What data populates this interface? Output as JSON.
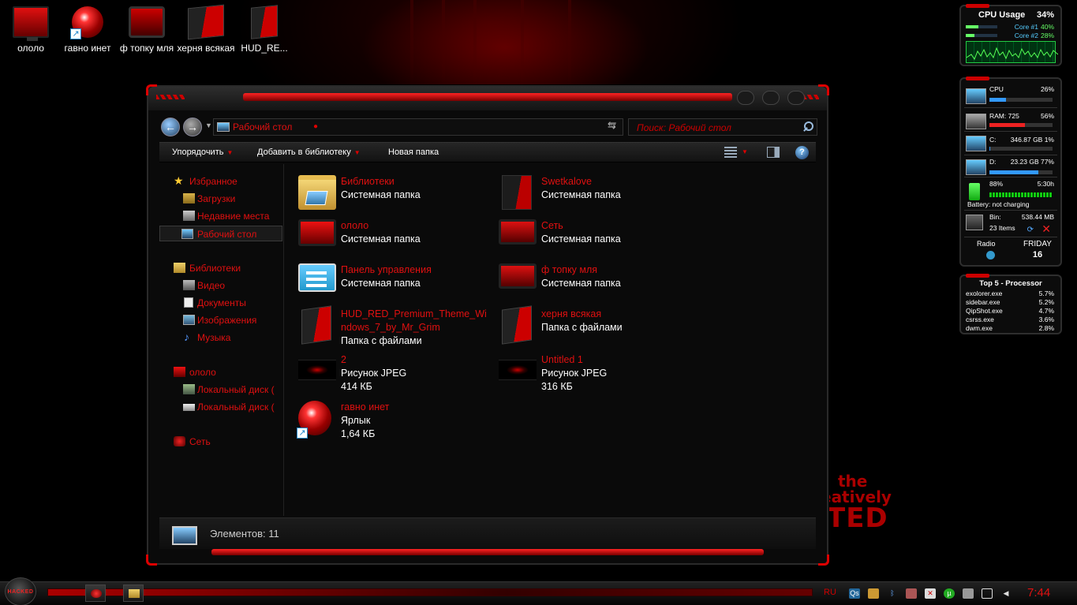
{
  "desktop": {
    "icons": [
      {
        "label": "ололо"
      },
      {
        "label": "гавно инет"
      },
      {
        "label": "ф топку мля"
      },
      {
        "label": "херня всякая"
      },
      {
        "label": "HUD_RE..."
      }
    ],
    "wallpaper_text": {
      "line1": "the",
      "line2": "eatively",
      "line3": "TED"
    }
  },
  "explorer": {
    "address": "Рабочий стол",
    "search_placeholder": "Поиск: Рабочий стол",
    "toolbar": {
      "organize": "Упорядочить",
      "add_to_library": "Добавить в библиотеку",
      "new_folder": "Новая папка"
    },
    "nav": {
      "favorites": "Избранное",
      "downloads": "Загрузки",
      "recent": "Недавние места",
      "desktop": "Рабочий стол",
      "libraries": "Библиотеки",
      "video": "Видео",
      "documents": "Документы",
      "images": "Изображения",
      "music": "Музыка",
      "ololo": "ололо",
      "local_disk_1": "Локальный диск (",
      "local_disk_2": "Локальный диск (",
      "network": "Сеть"
    },
    "items": [
      {
        "name": "Библиотеки",
        "type": "Системная папка"
      },
      {
        "name": "Swetkalove",
        "type": "Системная папка"
      },
      {
        "name": "ололо",
        "type": "Системная папка"
      },
      {
        "name": "Сеть",
        "type": "Системная папка"
      },
      {
        "name": "Панель управления",
        "type": "Системная папка"
      },
      {
        "name": "ф топку мля",
        "type": "Системная папка"
      },
      {
        "name": "HUD_RED_Premium_Theme_Windows_7_by_Mr_Grim",
        "type": "Папка с файлами"
      },
      {
        "name": "херня всякая",
        "type": "Папка с файлами"
      },
      {
        "name": "2",
        "type": "Рисунок JPEG",
        "size": "414 КБ"
      },
      {
        "name": "Untitled 1",
        "type": "Рисунок JPEG",
        "size": "316 КБ"
      },
      {
        "name": "гавно инет",
        "type": "Ярлык",
        "size": "1,64 КБ"
      }
    ],
    "status": "Элементов: 11"
  },
  "gadgets": {
    "cpu": {
      "title": "CPU Usage",
      "total": "34%",
      "core1_label": "Core #1",
      "core1": "40%",
      "core1_value": 40,
      "core2_label": "Core #2",
      "core2": "28%",
      "core2_value": 28
    },
    "monitor": {
      "cpu_label": "CPU",
      "cpu": "26%",
      "cpu_value": 26,
      "ram_label": "RAM: 725",
      "ram": "56%",
      "ram_value": 56,
      "c_label": "C:",
      "c": "346.87 GB 1%",
      "c_value": 1,
      "d_label": "D:",
      "d": "23.23 GB 77%",
      "d_value": 77,
      "battery_pct": "88%",
      "battery_time": "5:30h",
      "battery_status": "Battery: not charging",
      "bin_label": "Bin:",
      "bin_size": "538.44 MB",
      "bin_items": "23 Items",
      "radio": "Radio",
      "day": "FRIDAY",
      "date": "16"
    },
    "top5": {
      "title": "Top 5 - Processor",
      "rows": [
        {
          "name": "exolorer.exe",
          "value": "5.7%"
        },
        {
          "name": "sidebar.exe",
          "value": "5.2%"
        },
        {
          "name": "QipShot.exe",
          "value": "4.7%"
        },
        {
          "name": "csrss.exe",
          "value": "3.6%"
        },
        {
          "name": "dwm.exe",
          "value": "2.8%"
        }
      ]
    }
  },
  "taskbar": {
    "start_label": "HACKED",
    "language": "RU",
    "tray_qs": "Qs",
    "clock": "7:44"
  },
  "colors": {
    "accent": "#e01010",
    "background": "#000000"
  }
}
